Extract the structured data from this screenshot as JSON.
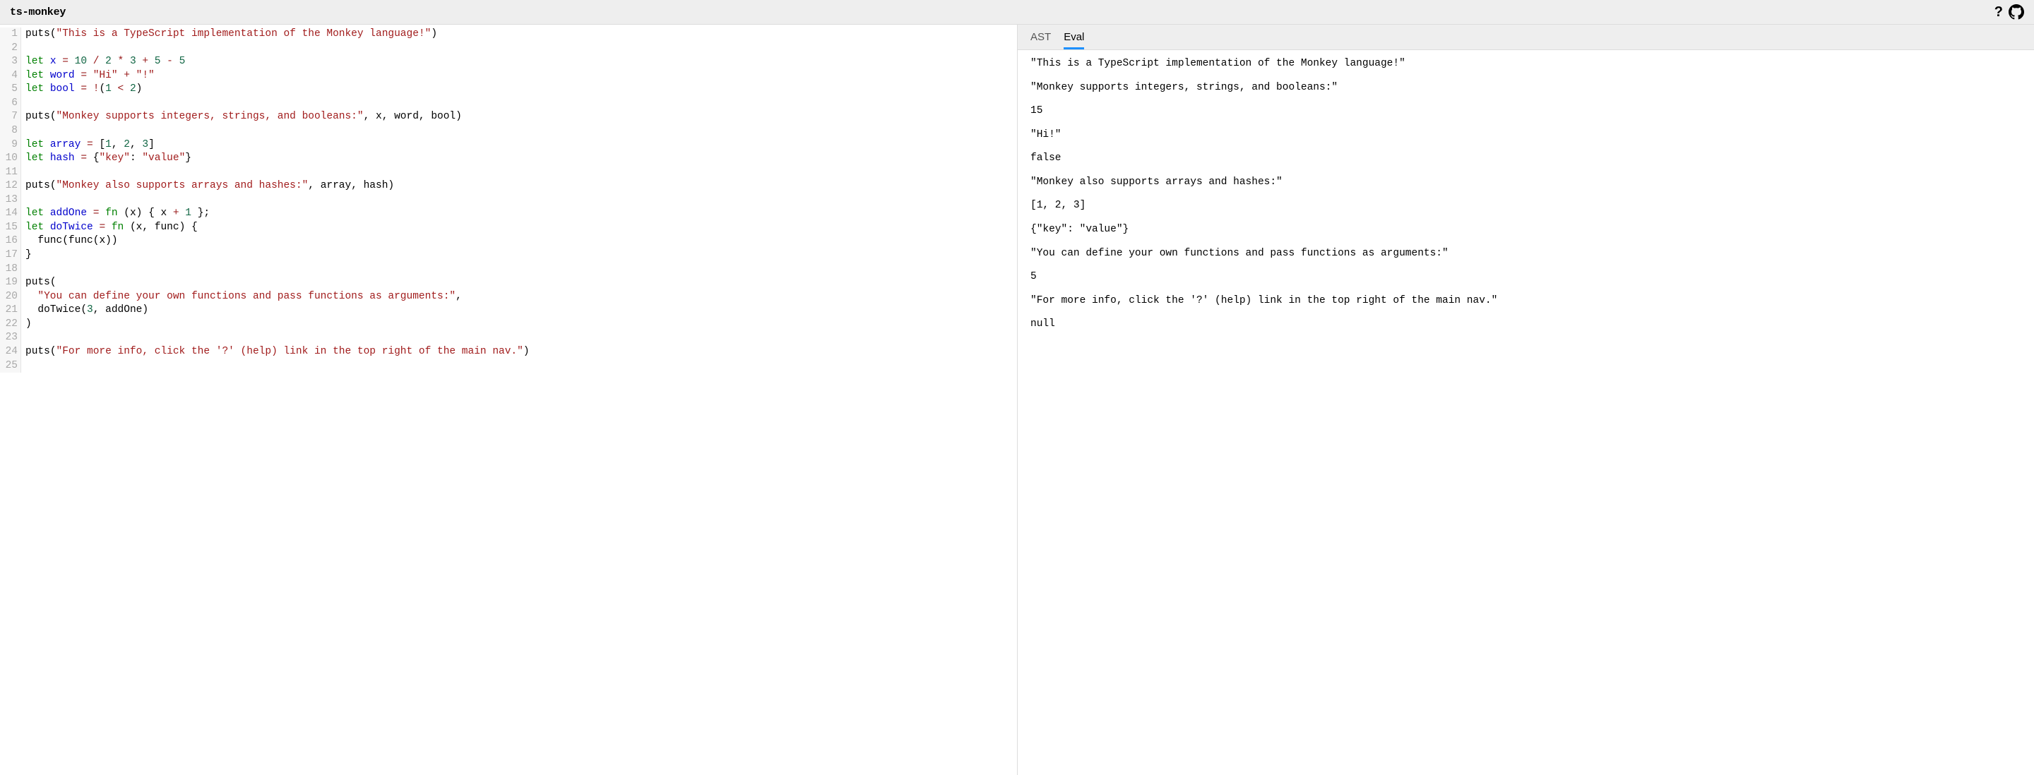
{
  "header": {
    "title": "ts-monkey",
    "help_label": "?",
    "github_label": "GitHub"
  },
  "editor": {
    "lines": [
      [
        [
          "id",
          "puts"
        ],
        [
          "punc",
          "("
        ],
        [
          "str",
          "\"This is a TypeScript implementation of the Monkey language!\""
        ],
        [
          "punc",
          ")"
        ]
      ],
      [],
      [
        [
          "kw",
          "let"
        ],
        [
          "sp",
          " "
        ],
        [
          "var",
          "x"
        ],
        [
          "sp",
          " "
        ],
        [
          "op",
          "="
        ],
        [
          "sp",
          " "
        ],
        [
          "num",
          "10"
        ],
        [
          "sp",
          " "
        ],
        [
          "op",
          "/"
        ],
        [
          "sp",
          " "
        ],
        [
          "num",
          "2"
        ],
        [
          "sp",
          " "
        ],
        [
          "op",
          "*"
        ],
        [
          "sp",
          " "
        ],
        [
          "num",
          "3"
        ],
        [
          "sp",
          " "
        ],
        [
          "op",
          "+"
        ],
        [
          "sp",
          " "
        ],
        [
          "num",
          "5"
        ],
        [
          "sp",
          " "
        ],
        [
          "op",
          "-"
        ],
        [
          "sp",
          " "
        ],
        [
          "num",
          "5"
        ]
      ],
      [
        [
          "kw",
          "let"
        ],
        [
          "sp",
          " "
        ],
        [
          "var",
          "word"
        ],
        [
          "sp",
          " "
        ],
        [
          "op",
          "="
        ],
        [
          "sp",
          " "
        ],
        [
          "str",
          "\"Hi\""
        ],
        [
          "sp",
          " "
        ],
        [
          "op",
          "+"
        ],
        [
          "sp",
          " "
        ],
        [
          "str",
          "\"!\""
        ]
      ],
      [
        [
          "kw",
          "let"
        ],
        [
          "sp",
          " "
        ],
        [
          "var",
          "bool"
        ],
        [
          "sp",
          " "
        ],
        [
          "op",
          "="
        ],
        [
          "sp",
          " "
        ],
        [
          "op",
          "!"
        ],
        [
          "punc",
          "("
        ],
        [
          "num",
          "1"
        ],
        [
          "sp",
          " "
        ],
        [
          "op",
          "<"
        ],
        [
          "sp",
          " "
        ],
        [
          "num",
          "2"
        ],
        [
          "punc",
          ")"
        ]
      ],
      [],
      [
        [
          "id",
          "puts"
        ],
        [
          "punc",
          "("
        ],
        [
          "str",
          "\"Monkey supports integers, strings, and booleans:\""
        ],
        [
          "punc",
          ","
        ],
        [
          "sp",
          " "
        ],
        [
          "id",
          "x"
        ],
        [
          "punc",
          ","
        ],
        [
          "sp",
          " "
        ],
        [
          "id",
          "word"
        ],
        [
          "punc",
          ","
        ],
        [
          "sp",
          " "
        ],
        [
          "id",
          "bool"
        ],
        [
          "punc",
          ")"
        ]
      ],
      [],
      [
        [
          "kw",
          "let"
        ],
        [
          "sp",
          " "
        ],
        [
          "var",
          "array"
        ],
        [
          "sp",
          " "
        ],
        [
          "op",
          "="
        ],
        [
          "sp",
          " "
        ],
        [
          "punc",
          "["
        ],
        [
          "num",
          "1"
        ],
        [
          "punc",
          ","
        ],
        [
          "sp",
          " "
        ],
        [
          "num",
          "2"
        ],
        [
          "punc",
          ","
        ],
        [
          "sp",
          " "
        ],
        [
          "num",
          "3"
        ],
        [
          "punc",
          "]"
        ]
      ],
      [
        [
          "kw",
          "let"
        ],
        [
          "sp",
          " "
        ],
        [
          "var",
          "hash"
        ],
        [
          "sp",
          " "
        ],
        [
          "op",
          "="
        ],
        [
          "sp",
          " "
        ],
        [
          "punc",
          "{"
        ],
        [
          "str",
          "\"key\""
        ],
        [
          "punc",
          ":"
        ],
        [
          "sp",
          " "
        ],
        [
          "str",
          "\"value\""
        ],
        [
          "punc",
          "}"
        ]
      ],
      [],
      [
        [
          "id",
          "puts"
        ],
        [
          "punc",
          "("
        ],
        [
          "str",
          "\"Monkey also supports arrays and hashes:\""
        ],
        [
          "punc",
          ","
        ],
        [
          "sp",
          " "
        ],
        [
          "id",
          "array"
        ],
        [
          "punc",
          ","
        ],
        [
          "sp",
          " "
        ],
        [
          "id",
          "hash"
        ],
        [
          "punc",
          ")"
        ]
      ],
      [],
      [
        [
          "kw",
          "let"
        ],
        [
          "sp",
          " "
        ],
        [
          "var",
          "addOne"
        ],
        [
          "sp",
          " "
        ],
        [
          "op",
          "="
        ],
        [
          "sp",
          " "
        ],
        [
          "kw",
          "fn"
        ],
        [
          "sp",
          " "
        ],
        [
          "punc",
          "("
        ],
        [
          "id",
          "x"
        ],
        [
          "punc",
          ")"
        ],
        [
          "sp",
          " "
        ],
        [
          "punc",
          "{"
        ],
        [
          "sp",
          " "
        ],
        [
          "id",
          "x"
        ],
        [
          "sp",
          " "
        ],
        [
          "op",
          "+"
        ],
        [
          "sp",
          " "
        ],
        [
          "num",
          "1"
        ],
        [
          "sp",
          " "
        ],
        [
          "punc",
          "}"
        ],
        [
          "punc",
          ";"
        ]
      ],
      [
        [
          "kw",
          "let"
        ],
        [
          "sp",
          " "
        ],
        [
          "var",
          "doTwice"
        ],
        [
          "sp",
          " "
        ],
        [
          "op",
          "="
        ],
        [
          "sp",
          " "
        ],
        [
          "kw",
          "fn"
        ],
        [
          "sp",
          " "
        ],
        [
          "punc",
          "("
        ],
        [
          "id",
          "x"
        ],
        [
          "punc",
          ","
        ],
        [
          "sp",
          " "
        ],
        [
          "id",
          "func"
        ],
        [
          "punc",
          ")"
        ],
        [
          "sp",
          " "
        ],
        [
          "punc",
          "{"
        ]
      ],
      [
        [
          "sp",
          "  "
        ],
        [
          "id",
          "func"
        ],
        [
          "punc",
          "("
        ],
        [
          "id",
          "func"
        ],
        [
          "punc",
          "("
        ],
        [
          "id",
          "x"
        ],
        [
          "punc",
          ")"
        ],
        [
          "punc",
          ")"
        ]
      ],
      [
        [
          "punc",
          "}"
        ]
      ],
      [],
      [
        [
          "id",
          "puts"
        ],
        [
          "punc",
          "("
        ]
      ],
      [
        [
          "sp",
          "  "
        ],
        [
          "str",
          "\"You can define your own functions and pass functions as arguments:\""
        ],
        [
          "punc",
          ","
        ]
      ],
      [
        [
          "sp",
          "  "
        ],
        [
          "id",
          "doTwice"
        ],
        [
          "punc",
          "("
        ],
        [
          "num",
          "3"
        ],
        [
          "punc",
          ","
        ],
        [
          "sp",
          " "
        ],
        [
          "id",
          "addOne"
        ],
        [
          "punc",
          ")"
        ]
      ],
      [
        [
          "punc",
          ")"
        ]
      ],
      [],
      [
        [
          "id",
          "puts"
        ],
        [
          "punc",
          "("
        ],
        [
          "str",
          "\"For more info, click the '?' (help) link in the top right of the main nav.\""
        ],
        [
          "punc",
          ")"
        ]
      ],
      []
    ]
  },
  "tabs": {
    "items": [
      "AST",
      "Eval"
    ],
    "active_index": 1
  },
  "output": {
    "lines": [
      "\"This is a TypeScript implementation of the Monkey language!\"",
      "\"Monkey supports integers, strings, and booleans:\"",
      "15",
      "\"Hi!\"",
      "false",
      "\"Monkey also supports arrays and hashes:\"",
      "[1, 2, 3]",
      "{\"key\": \"value\"}",
      "\"You can define your own functions and pass functions as arguments:\"",
      "5",
      "\"For more info, click the '?' (help) link in the top right of the main nav.\"",
      "null"
    ]
  }
}
